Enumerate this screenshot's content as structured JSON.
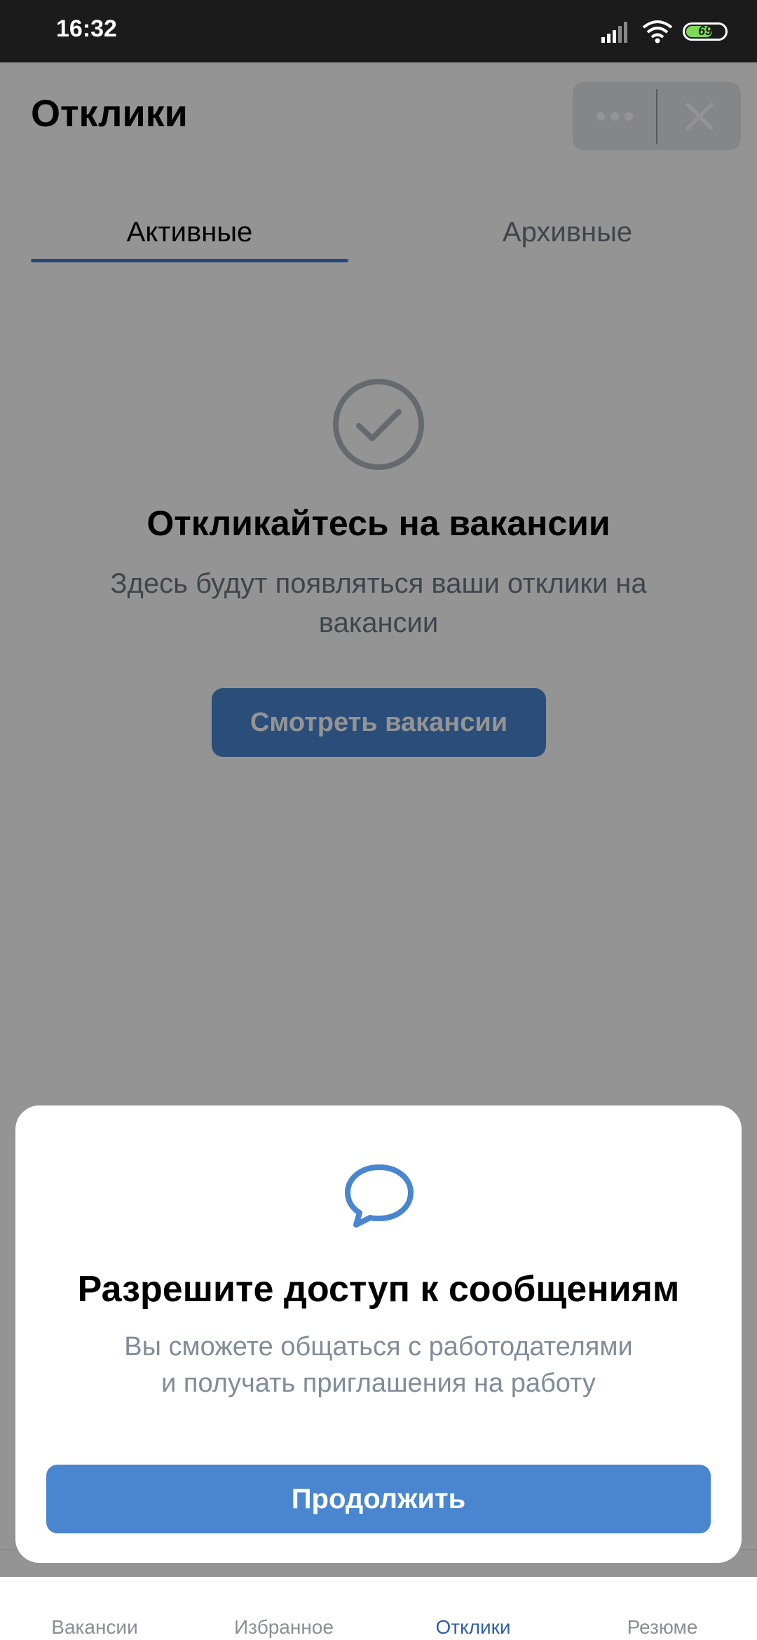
{
  "status_bar": {
    "time": "16:32",
    "battery": "69"
  },
  "header": {
    "title": "Отклики"
  },
  "tabs": [
    {
      "label": "Активные",
      "active": true
    },
    {
      "label": "Архивные",
      "active": false
    }
  ],
  "empty_state": {
    "title": "Откликайтесь на вакансии",
    "subtitle": "Здесь будут появляться ваши отклики на вакансии",
    "button": "Смотреть вакансии"
  },
  "bottom_nav": [
    {
      "label": "Вакансии"
    },
    {
      "label": "Избранное"
    },
    {
      "label": "Отклики",
      "active": true
    },
    {
      "label": "Резюме"
    }
  ],
  "sheet": {
    "title": "Разрешите доступ к сообщениям",
    "subtitle_line1": "Вы сможете общаться с работодателями",
    "subtitle_line2": "и получать приглашения на работу",
    "button": "Продолжить"
  },
  "colors": {
    "accent": "#4a86cf",
    "tab_underline": "#3f7dd1",
    "secondary_text": "#6d7885"
  }
}
